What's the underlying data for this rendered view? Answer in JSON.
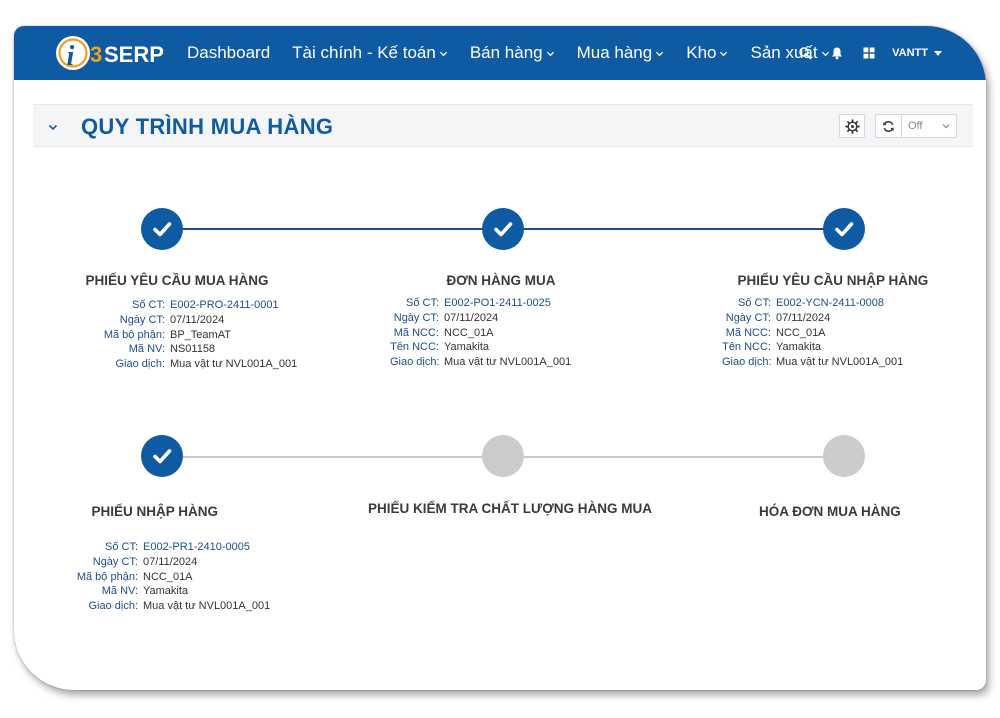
{
  "nav": {
    "logo_text": "3SERP",
    "items": [
      {
        "label": "Dashboard",
        "dropdown": false
      },
      {
        "label": "Tài chính - Kế toán",
        "dropdown": true
      },
      {
        "label": "Bán hàng",
        "dropdown": true
      },
      {
        "label": "Mua hàng",
        "dropdown": true
      },
      {
        "label": "Kho",
        "dropdown": true
      },
      {
        "label": "Sản xuất",
        "dropdown": true
      }
    ],
    "user": "VANTT"
  },
  "header": {
    "title": "QUY TRÌNH MUA HÀNG",
    "refresh_value": "Off"
  },
  "steps": [
    {
      "title": "PHIẾU YÊU CẦU MUA HÀNG",
      "status": "done",
      "fields": [
        {
          "label": "Số CT:",
          "value": "E002-PRO-2411-0001",
          "link": true
        },
        {
          "label": "Ngày CT:",
          "value": "07/11/2024",
          "link": false
        },
        {
          "label": "Mã bộ phận:",
          "value": "BP_TeamAT",
          "link": false
        },
        {
          "label": "Mã NV:",
          "value": "NS01158",
          "link": false
        },
        {
          "label": "Giao dịch:",
          "value": "Mua vật tư NVL001A_001",
          "link": false
        }
      ]
    },
    {
      "title": "ĐƠN HÀNG MUA",
      "status": "done",
      "fields": [
        {
          "label": "Số CT:",
          "value": "E002-PO1-2411-0025",
          "link": true
        },
        {
          "label": "Ngày CT:",
          "value": "07/11/2024",
          "link": false
        },
        {
          "label": "Mã NCC:",
          "value": "NCC_01A",
          "link": false
        },
        {
          "label": "Tên NCC:",
          "value": "Yamakita",
          "link": false
        },
        {
          "label": "Giao dịch:",
          "value": "Mua vật tư NVL001A_001",
          "link": false
        }
      ]
    },
    {
      "title": "PHIẾU YÊU CẦU NHẬP HÀNG",
      "status": "done",
      "fields": [
        {
          "label": "Số CT:",
          "value": "E002-YCN-2411-0008",
          "link": true
        },
        {
          "label": "Ngày CT:",
          "value": "07/11/2024",
          "link": false
        },
        {
          "label": "Mã NCC:",
          "value": "NCC_01A",
          "link": false
        },
        {
          "label": "Tên NCC:",
          "value": "Yamakita",
          "link": false
        },
        {
          "label": "Giao dịch:",
          "value": "Mua vật tư NVL001A_001",
          "link": false
        }
      ]
    },
    {
      "title": "PHIẾU NHẬP HÀNG",
      "status": "done",
      "fields": [
        {
          "label": "Số CT:",
          "value": "E002-PR1-2410-0005",
          "link": true
        },
        {
          "label": "Ngày CT:",
          "value": "07/11/2024",
          "link": false
        },
        {
          "label": "Mã bộ phận:",
          "value": "NCC_01A",
          "link": false
        },
        {
          "label": "Mã NV:",
          "value": "Yamakita",
          "link": false
        },
        {
          "label": "Giao dịch:",
          "value": "Mua vật tư NVL001A_001",
          "link": false
        }
      ]
    },
    {
      "title": "PHIẾU KIỂM TRA CHẤT LƯỢNG HÀNG MUA",
      "status": "pending",
      "fields": []
    },
    {
      "title": "HÓA ĐƠN MUA HÀNG",
      "status": "pending",
      "fields": []
    }
  ],
  "colors": {
    "primary": "#0f5ba3",
    "pending": "#cccccc",
    "label": "#1a4f8b"
  }
}
